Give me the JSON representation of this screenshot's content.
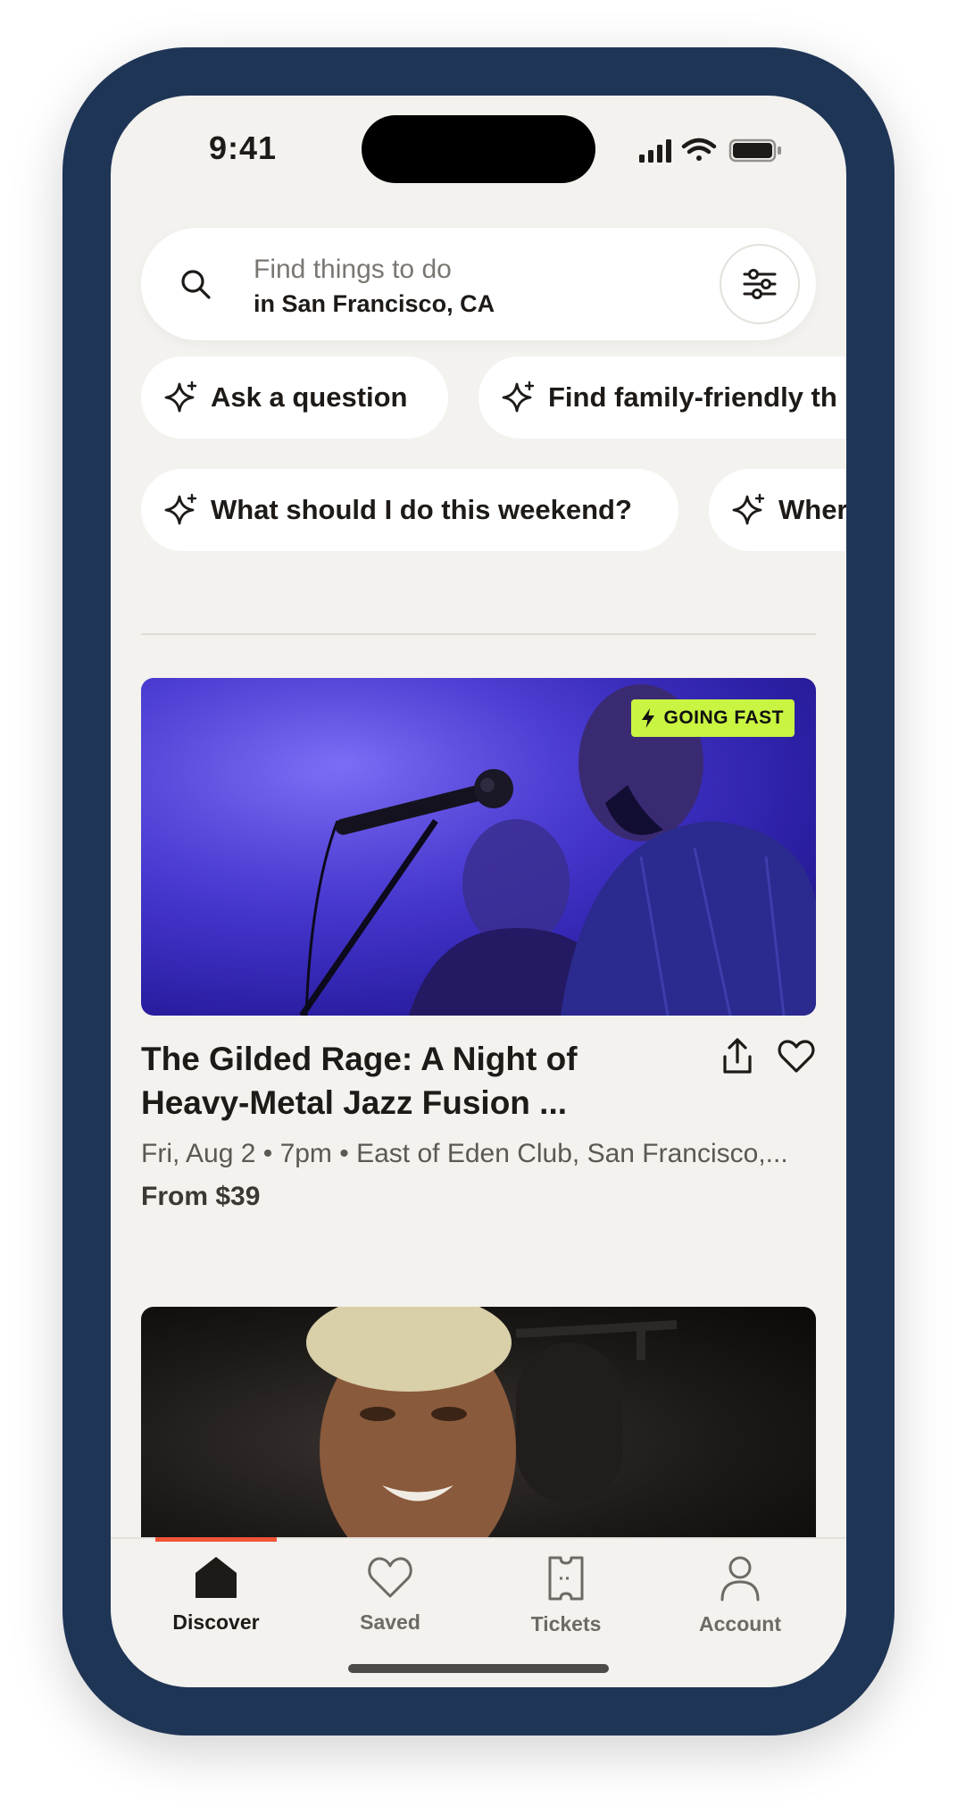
{
  "status_bar": {
    "time": "9:41"
  },
  "search": {
    "placeholder": "Find things to do",
    "location": "in San Francisco, CA",
    "search_icon": "search-icon",
    "filter_icon": "sliders-icon"
  },
  "chips_row1": [
    {
      "label": "Ask a question",
      "icon": "sparkle-icon"
    },
    {
      "label": "Find family-friendly th",
      "icon": "sparkle-icon"
    }
  ],
  "chips_row2": [
    {
      "label": "What should I do this weekend?",
      "icon": "sparkle-icon"
    },
    {
      "label": "Wher",
      "icon": "sparkle-icon"
    }
  ],
  "events": [
    {
      "badge": "GOING FAST",
      "title": "The Gilded Rage: A Night of Heavy-Metal Jazz Fusion ...",
      "meta": "Fri, Aug 2 • 7pm • East of Eden Club, San Francisco,...",
      "price": "From $39"
    }
  ],
  "tabs": [
    {
      "label": "Discover",
      "icon": "home-icon",
      "active": true
    },
    {
      "label": "Saved",
      "icon": "heart-icon",
      "active": false
    },
    {
      "label": "Tickets",
      "icon": "ticket-icon",
      "active": false
    },
    {
      "label": "Account",
      "icon": "person-icon",
      "active": false
    }
  ],
  "colors": {
    "device_frame": "#1f3556",
    "background": "#f3f2ee",
    "badge": "#c9f542",
    "accent": "#f05537"
  }
}
